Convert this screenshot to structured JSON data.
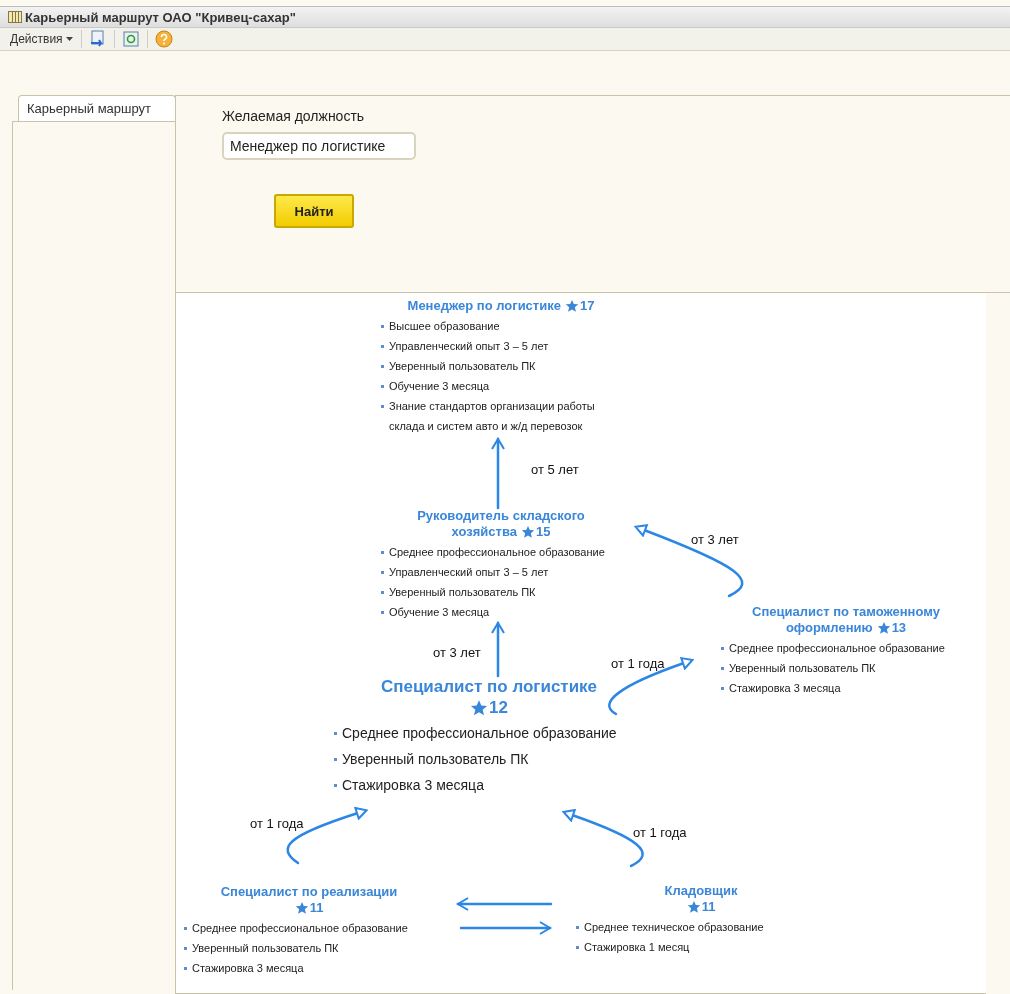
{
  "window": {
    "title": "Карьерный маршрут ОАО \"Кривец-сахар\""
  },
  "toolbar": {
    "menu": "Действия"
  },
  "tabs": [
    {
      "label": "Карьерный маршрут",
      "selected": true
    }
  ],
  "search": {
    "label": "Желаемая должность",
    "value": "Менеджер по логистике",
    "button": "Найти"
  },
  "diagram": {
    "nodes": [
      {
        "kind": "regular",
        "title": [
          "Менеджер по логистике"
        ],
        "rank": "17",
        "requirements": [
          "Высшее образование",
          "Управленческий опыт 3 – 5 лет",
          "Уверенный пользователь ПК",
          "Обучение 3 месяца",
          "Знание стандартов организации работы склада и систем авто и ж/д перевозок"
        ]
      },
      {
        "kind": "regular",
        "title": [
          "Руководитель складского",
          "хозяйства"
        ],
        "rank": "15",
        "requirements": [
          "Среднее профессиональное образование",
          "Управленческий опыт 3 – 5 лет",
          "Уверенный пользователь ПК",
          "Обучение 3 месяца"
        ]
      },
      {
        "kind": "regular",
        "title": [
          "Специалист по таможенному",
          "оформлению"
        ],
        "rank": "13",
        "requirements": [
          "Среднее профессиональное образование",
          "Уверенный пользователь ПК",
          "Стажировка 3 месяца"
        ]
      },
      {
        "kind": "main",
        "title": [
          "Специалист по логистике"
        ],
        "rank": "12",
        "requirements": [
          "Среднее профессиональное образование",
          "Уверенный пользователь ПК",
          "Стажировка 3 месяца"
        ]
      },
      {
        "kind": "regular",
        "title": [
          "Специалист по реализации"
        ],
        "rank": "11",
        "requirements": [
          "Среднее профессиональное образование",
          "Уверенный пользователь ПК",
          "Стажировка 3 месяца"
        ]
      },
      {
        "kind": "regular",
        "title": [
          "Кладовщик"
        ],
        "rank": "11",
        "requirements": [
          "Среднее техническое образование",
          "Стажировка 1 месяц"
        ]
      }
    ],
    "edges": [
      {
        "kind": "straight",
        "label": "от 5 лет"
      },
      {
        "kind": "curved",
        "label": "от 3 лет"
      },
      {
        "kind": "straight",
        "label": "от 3 лет"
      },
      {
        "kind": "curved",
        "label": "от 1 года"
      },
      {
        "kind": "curved",
        "label": "от 1 года"
      },
      {
        "kind": "curved",
        "label": "от 1 года"
      },
      {
        "kind": "straight"
      },
      {
        "kind": "straight"
      }
    ]
  }
}
